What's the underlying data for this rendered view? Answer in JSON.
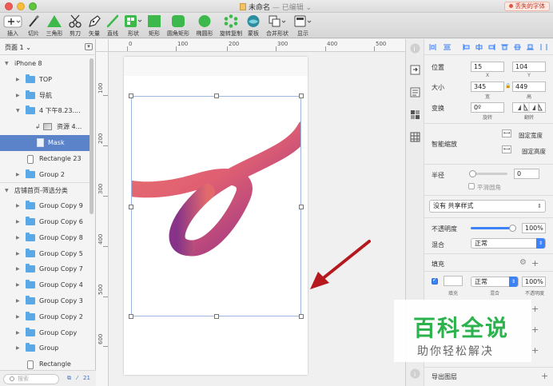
{
  "window": {
    "title": "未命名",
    "edited_suffix": "— 已编辑",
    "missing_fonts": "丢失的字体"
  },
  "toolbar": {
    "items": [
      {
        "label": "插入",
        "icon": "plus-icon"
      },
      {
        "label": "切片",
        "icon": "knife-icon"
      },
      {
        "label": "三角形",
        "icon": "triangle-icon"
      },
      {
        "label": "剪刀",
        "icon": "scissors-icon"
      },
      {
        "label": "矢量",
        "icon": "pen-icon"
      },
      {
        "label": "直线",
        "icon": "line-icon"
      },
      {
        "label": "形状",
        "icon": "shapes-icon"
      },
      {
        "label": "矩形",
        "icon": "rectangle-icon"
      },
      {
        "label": "圆角矩形",
        "icon": "rounded-rectangle-icon"
      },
      {
        "label": "椭圆形",
        "icon": "oval-icon"
      },
      {
        "label": "旋转复制",
        "icon": "rotate-copy-icon"
      },
      {
        "label": "蒙板",
        "icon": "mask-icon"
      },
      {
        "label": "合并形状",
        "icon": "combine-icon"
      },
      {
        "label": "显示",
        "icon": "view-icon"
      }
    ],
    "accent_green": "#3cb94a",
    "accent_teal": "#2a8e9e"
  },
  "pages": {
    "title": "页面 1",
    "chevron": "⌄"
  },
  "layers": [
    {
      "label": "iPhone 8",
      "kind": "artboard-section"
    },
    {
      "label": "TOP",
      "kind": "group"
    },
    {
      "label": "导航",
      "kind": "group"
    },
    {
      "label": "4 下午8.23....",
      "kind": "group-open"
    },
    {
      "label": "资源 4...",
      "kind": "image"
    },
    {
      "label": "Mask",
      "kind": "mask",
      "selected": true
    },
    {
      "label": "Rectangle 23",
      "kind": "rect"
    },
    {
      "label": "Group 2",
      "kind": "group"
    },
    {
      "label": "店铺首页-筛选分类",
      "kind": "artboard-section"
    },
    {
      "label": "Group Copy 9",
      "kind": "group"
    },
    {
      "label": "Group Copy 6",
      "kind": "group"
    },
    {
      "label": "Group Copy 8",
      "kind": "group"
    },
    {
      "label": "Group Copy 5",
      "kind": "group"
    },
    {
      "label": "Group Copy 7",
      "kind": "group"
    },
    {
      "label": "Group Copy 4",
      "kind": "group"
    },
    {
      "label": "Group Copy 3",
      "kind": "group"
    },
    {
      "label": "Group Copy 2",
      "kind": "group"
    },
    {
      "label": "Group Copy",
      "kind": "group"
    },
    {
      "label": "Group",
      "kind": "group"
    },
    {
      "label": "Rectangle",
      "kind": "rect"
    }
  ],
  "layer_footer": {
    "search_placeholder": "搜索",
    "count": "21"
  },
  "ruler": {
    "top": [
      "0",
      "100",
      "200",
      "300",
      "400",
      "500"
    ],
    "left": [
      "100",
      "200",
      "300",
      "400",
      "500",
      "600"
    ]
  },
  "inspector": {
    "position_label": "位置",
    "x_value": "15",
    "y_value": "104",
    "x_sub": "X",
    "y_sub": "Y",
    "size_label": "大小",
    "width_value": "345",
    "height_value": "449",
    "width_sub": "宽",
    "height_sub": "高",
    "transform_label": "变换",
    "rotate_value": "0º",
    "rotate_sub": "旋转",
    "flip_sub": "翻转",
    "smart_resize_label": "智能缩放",
    "fix_width_label": "固定宽度",
    "fix_height_label": "固定高度",
    "radius_label": "半径",
    "radius_value": "0",
    "smooth_corners_label": "平滑圆角",
    "shared_style": "没有 共享样式",
    "opacity_label": "不透明度",
    "opacity_value": "100%",
    "blend_label": "混合",
    "blend_value": "正常",
    "fill_label": "填充",
    "fill_blend_value": "正常",
    "fill_opacity_value": "100%",
    "fill_sub_fill": "填充",
    "fill_sub_blend": "混合",
    "fill_sub_opacity": "不透明度",
    "export_label": "导出图层",
    "accent_blue": "#3e82f7"
  },
  "watermark": {
    "main": "百科全说",
    "sub": "助你轻松解决"
  },
  "annotation": {
    "arrow_color": "#b5181d"
  }
}
